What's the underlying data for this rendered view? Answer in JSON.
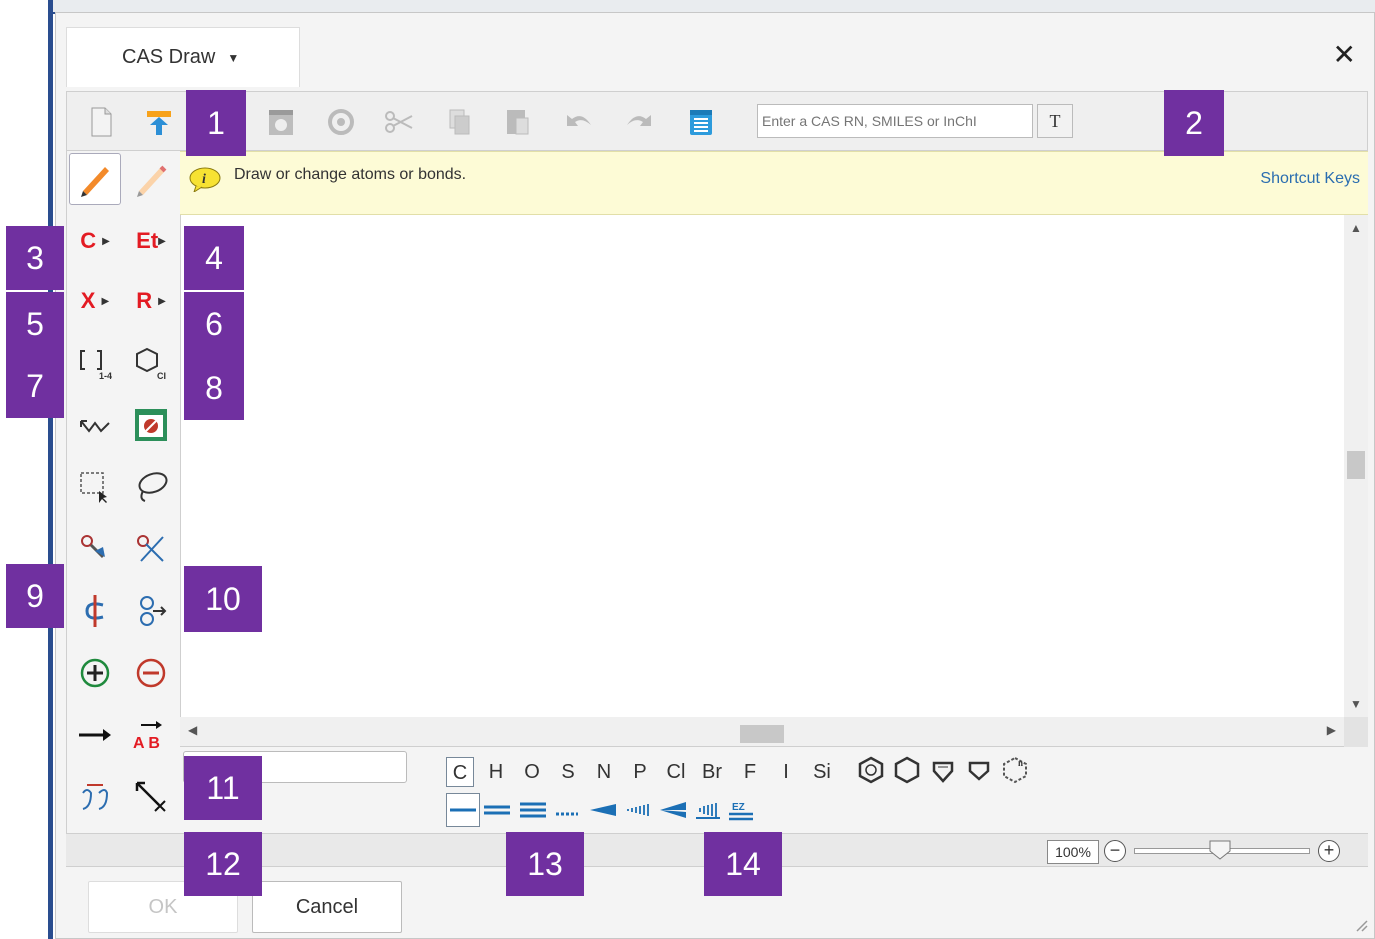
{
  "dialog": {
    "title": "CAS Draw",
    "close_label": "✕"
  },
  "toolbar": {
    "search": {
      "placeholder": "Enter a CAS RN, SMILES or InChI"
    },
    "search_button_label": "T"
  },
  "hint": {
    "text": "Draw or change atoms or bonds.",
    "shortcut_keys": "Shortcut Keys"
  },
  "tools": {
    "carbon": "C",
    "ethyl": "Et",
    "halogen": "X",
    "rgroup": "R",
    "repeat_sub": "1-4",
    "ring_sub": "CI",
    "reaction_label": "A B"
  },
  "atoms": [
    "C",
    "H",
    "O",
    "S",
    "N",
    "P",
    "Cl",
    "Br",
    "F",
    "I",
    "Si"
  ],
  "zoom": {
    "value": "100%",
    "minus": "−",
    "plus": "+"
  },
  "buttons": {
    "ok": "OK",
    "cancel": "Cancel"
  },
  "callouts": [
    "1",
    "2",
    "3",
    "4",
    "5",
    "6",
    "7",
    "8",
    "9",
    "10",
    "11",
    "12",
    "13",
    "14"
  ]
}
